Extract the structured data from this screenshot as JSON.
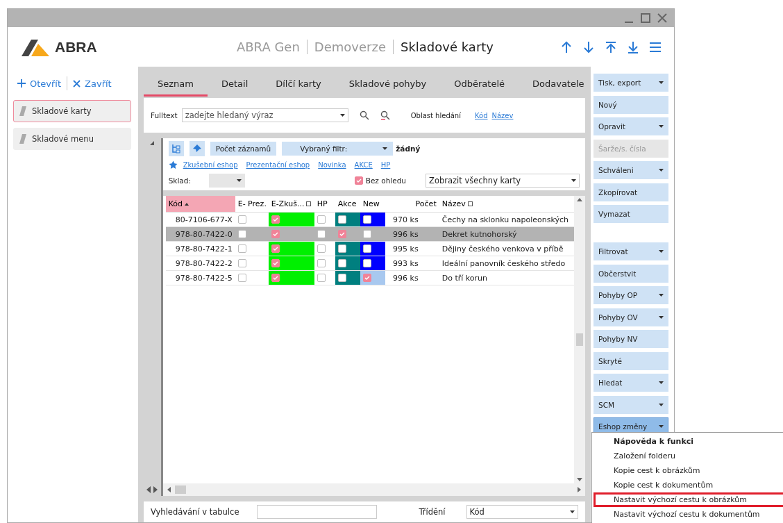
{
  "header": {
    "logo": "ABRA",
    "title_parts": [
      "ABRA Gen",
      "Demoverze",
      "Skladové karty"
    ]
  },
  "nav_actions": [
    "Otevřít",
    "Zavřít"
  ],
  "sidebar": {
    "items": [
      {
        "label": "Skladové karty",
        "selected": true
      },
      {
        "label": "Skladové menu",
        "selected": false
      }
    ]
  },
  "tabs": [
    {
      "label": "Seznam",
      "selected": true
    },
    {
      "label": "Detail",
      "selected": false
    },
    {
      "label": "Dílčí karty",
      "selected": false
    },
    {
      "label": "Skladové pohyby",
      "selected": false
    },
    {
      "label": "Odběratelé",
      "selected": false
    },
    {
      "label": "Dodavatele",
      "selected": false
    }
  ],
  "search": {
    "label": "Fulltext",
    "placeholder": "zadejte hledaný výraz",
    "scope_label": "Oblast hledání",
    "scope_links": [
      "Kód",
      "Název"
    ]
  },
  "filter_bar": {
    "count_button": "Počet záznamů",
    "filter_label": "Vybraný filtr:",
    "filter_value": "žádný",
    "quick_links": [
      "Zkušební eshop",
      "Prezentační eshop",
      "Novinka",
      "AKCE",
      "HP"
    ],
    "store_label": "Sklad:",
    "ignore": {
      "label": "Bez ohledu",
      "checked": true
    },
    "view": "Zobrazit všechny karty"
  },
  "table": {
    "columns": [
      "Kód",
      "E- Prez.",
      "E-Zkuš...",
      "HP",
      "Akce",
      "New",
      "Počet",
      "Název"
    ],
    "rows": [
      {
        "code": "80-7106-677-X",
        "e_prez": false,
        "e_zkus": true,
        "hp": false,
        "akce": false,
        "new": false,
        "count": "970 ks",
        "name": "Čechy na sklonku napoleonských",
        "selected": false
      },
      {
        "code": "978-80-7422-0",
        "e_prez": false,
        "e_zkus": true,
        "hp": false,
        "akce": true,
        "new": false,
        "count": "996 ks",
        "name": "Dekret kutnohorský",
        "selected": true
      },
      {
        "code": "978-80-7422-1",
        "e_prez": false,
        "e_zkus": true,
        "hp": false,
        "akce": false,
        "new": false,
        "count": "995 ks",
        "name": "Dějiny českého venkova v příbě",
        "selected": false
      },
      {
        "code": "978-80-7422-2",
        "e_prez": false,
        "e_zkus": true,
        "hp": false,
        "akce": false,
        "new": false,
        "count": "993 ks",
        "name": "Ideální panovník českého středo",
        "selected": false
      },
      {
        "code": "978-80-7422-5",
        "e_prez": false,
        "e_zkus": true,
        "hp": false,
        "akce": false,
        "new": true,
        "count": "996 ks",
        "name": "Do tří korun",
        "selected": false
      }
    ]
  },
  "bottom": {
    "search_label": "Vyhledávání v tabulce",
    "sort_label": "Třídění",
    "sort_value": "Kód"
  },
  "side_buttons": [
    [
      {
        "label": "Tisk, export",
        "kind": "dropdown",
        "disabled": false,
        "open": false
      },
      {
        "label": "Nový",
        "kind": "plain",
        "disabled": false,
        "open": false
      },
      {
        "label": "Opravit",
        "kind": "dropdown",
        "disabled": false,
        "open": false
      },
      {
        "label": "Šarže/s. čísla",
        "kind": "plain",
        "disabled": true,
        "open": false
      },
      {
        "label": "Schváleni",
        "kind": "dropdown",
        "disabled": false,
        "open": false
      },
      {
        "label": "Zkopírovat",
        "kind": "plain",
        "disabled": false,
        "open": false
      },
      {
        "label": "Vymazat",
        "kind": "plain",
        "disabled": false,
        "open": false
      }
    ],
    [
      {
        "label": "Filtrovat",
        "kind": "dropdown",
        "disabled": false,
        "open": false
      },
      {
        "label": "Občerstvit",
        "kind": "plain",
        "disabled": false,
        "open": false
      },
      {
        "label": "Pohyby OP",
        "kind": "dropdown",
        "disabled": false,
        "open": false
      },
      {
        "label": "Pohyby OV",
        "kind": "dropdown",
        "disabled": false,
        "open": false
      },
      {
        "label": "Pohyby NV",
        "kind": "plain",
        "disabled": false,
        "open": false
      },
      {
        "label": "Skryté",
        "kind": "plain",
        "disabled": false,
        "open": false
      },
      {
        "label": "Hledat",
        "kind": "dropdown",
        "disabled": false,
        "open": false
      },
      {
        "label": "SCM",
        "kind": "dropdown",
        "disabled": false,
        "open": false
      },
      {
        "label": "Eshop změny",
        "kind": "dropdown",
        "disabled": false,
        "open": true
      }
    ]
  ],
  "menu": [
    {
      "label": "Nápověda k funkci",
      "bold": true,
      "highlighted": false
    },
    {
      "label": "Založení folderu",
      "bold": false,
      "highlighted": false
    },
    {
      "label": "Kopie cest k obrázkům",
      "bold": false,
      "highlighted": false
    },
    {
      "label": "Kopie cest k dokumentům",
      "bold": false,
      "highlighted": false
    },
    {
      "label": "Nastavit výchozí cestu k obrázkům",
      "bold": false,
      "highlighted": true
    },
    {
      "label": "Nastavit výchozí cestu k dokumentům",
      "bold": false,
      "highlighted": false
    }
  ]
}
